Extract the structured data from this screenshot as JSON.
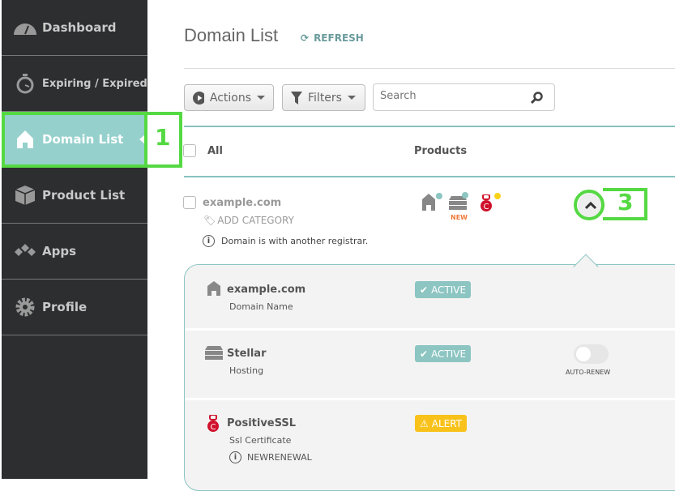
{
  "sidebar": {
    "items": [
      {
        "label": "Dashboard",
        "icon": "dashboard-gauge-icon"
      },
      {
        "label": "Expiring / Expired",
        "icon": "stopwatch-icon"
      },
      {
        "label": "Domain List",
        "icon": "house-icon",
        "active": true
      },
      {
        "label": "Product List",
        "icon": "box-icon"
      },
      {
        "label": "Apps",
        "icon": "apps-diamonds-icon"
      },
      {
        "label": "Profile",
        "icon": "gear-icon"
      }
    ]
  },
  "annotations": [
    "1",
    "3"
  ],
  "header": {
    "title": "Domain List",
    "refresh": "REFRESH"
  },
  "toolbar": {
    "actions": "Actions",
    "filters": "Filters",
    "search_placeholder": "Search"
  },
  "table": {
    "col_all": "All",
    "col_products": "Products"
  },
  "row": {
    "domain": "example.com",
    "add_category": "ADD CATEGORY",
    "note": "Domain is with another registrar.",
    "new_label": "NEW"
  },
  "details": [
    {
      "name": "example.com",
      "type": "Domain Name",
      "status": "ACTIVE"
    },
    {
      "name": "Stellar",
      "type": "Hosting",
      "status": "ACTIVE",
      "toggle_label": "AUTO-RENEW",
      "auto_renew": false
    },
    {
      "name": "PositiveSSL",
      "type": "Ssl Certificate",
      "status": "ALERT",
      "note": "NEWRENEWAL"
    }
  ],
  "colors": {
    "sidebar": "#2d2e30",
    "accent": "#95d0cc",
    "active_badge": "#8cc5c2",
    "alert_badge": "#f9c21b",
    "ssl_red": "#d0112b",
    "annotation": "#55d943"
  }
}
